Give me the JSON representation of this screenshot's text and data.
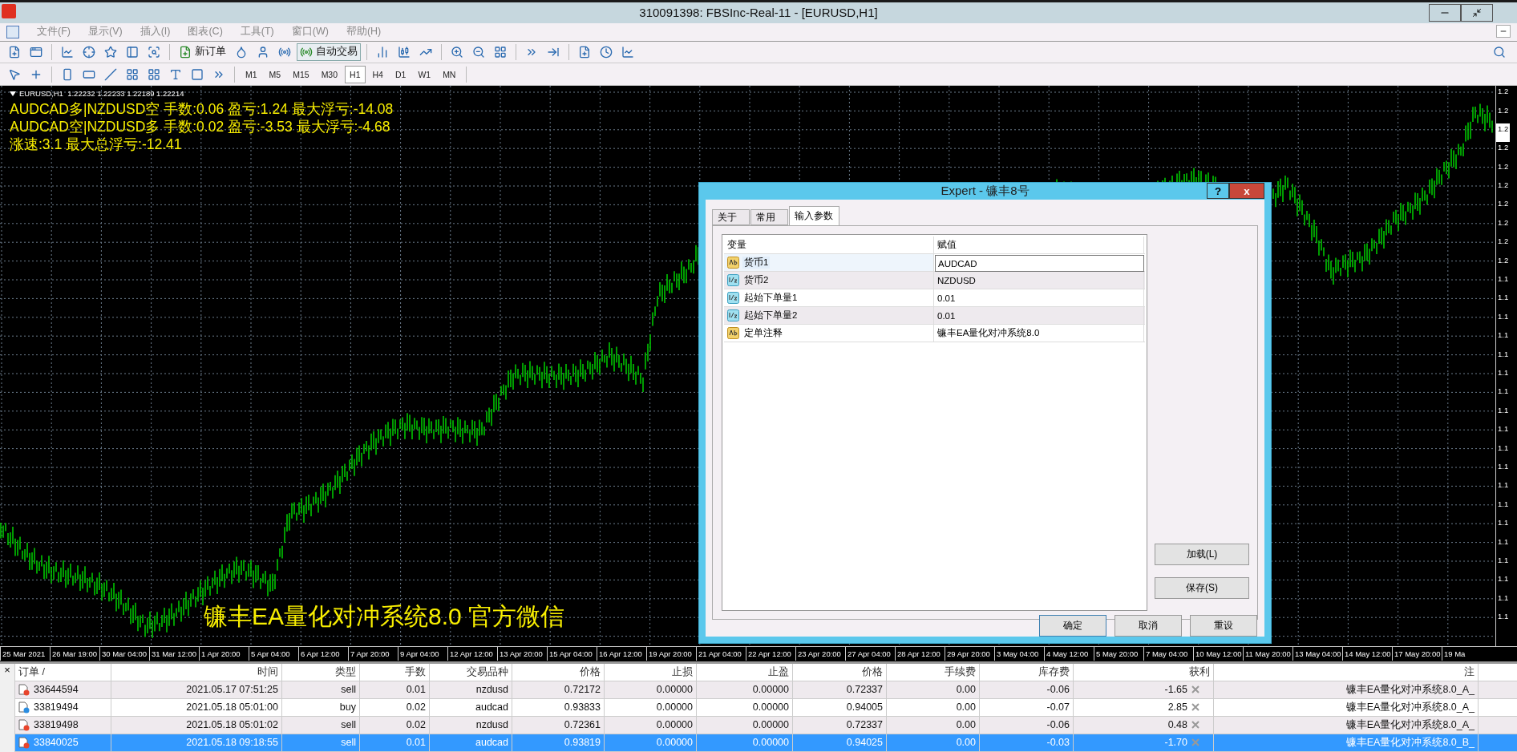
{
  "window": {
    "title": "310091398: FBSInc-Real-11 - [EURUSD,H1]"
  },
  "menu": [
    "文件(F)",
    "显示(V)",
    "插入(I)",
    "图表(C)",
    "工具(T)",
    "窗口(W)",
    "帮助(H)"
  ],
  "toolbar": {
    "buttons": [
      "新订单",
      "自动交易"
    ]
  },
  "timeframes": [
    {
      "label": "M1",
      "selected": false
    },
    {
      "label": "M5",
      "selected": false
    },
    {
      "label": "M15",
      "selected": false
    },
    {
      "label": "M30",
      "selected": false
    },
    {
      "label": "H1",
      "selected": true
    },
    {
      "label": "H4",
      "selected": false
    },
    {
      "label": "D1",
      "selected": false
    },
    {
      "label": "W1",
      "selected": false
    },
    {
      "label": "MN",
      "selected": false
    }
  ],
  "chart": {
    "header": "EURUSD,H1  1.22232 1.22233 1.22189 1.22214",
    "overlay_lines": [
      "AUDCAD多|NZDUSD空  手数:0.06  盈亏:1.24  最大浮亏:-14.08",
      "AUDCAD空|NZDUSD多  手数:0.02  盈亏:-3.53  最大浮亏:-4.68",
      "涨速:3.1  最大总浮亏:-12.41"
    ],
    "banner": "镰丰EA量化对冲系统8.0  官方微信",
    "price_labels": [
      {
        "text": "1.2",
        "current": false
      },
      {
        "text": "1.2",
        "current": false
      },
      {
        "text": "1.2",
        "current": true
      },
      {
        "text": "1.2",
        "current": false
      },
      {
        "text": "1.2",
        "current": false
      },
      {
        "text": "1.2",
        "current": false
      },
      {
        "text": "1.2",
        "current": false
      },
      {
        "text": "1.2",
        "current": false
      },
      {
        "text": "1.2",
        "current": false
      },
      {
        "text": "1.2",
        "current": false
      },
      {
        "text": "1.1",
        "current": false
      },
      {
        "text": "1.1",
        "current": false
      },
      {
        "text": "1.1",
        "current": false
      },
      {
        "text": "1.1",
        "current": false
      },
      {
        "text": "1.1",
        "current": false
      },
      {
        "text": "1.1",
        "current": false
      },
      {
        "text": "1.1",
        "current": false
      },
      {
        "text": "1.1",
        "current": false
      },
      {
        "text": "1.1",
        "current": false
      },
      {
        "text": "1.1",
        "current": false
      },
      {
        "text": "1.1",
        "current": false
      },
      {
        "text": "1.1",
        "current": false
      },
      {
        "text": "1.1",
        "current": false
      },
      {
        "text": "1.1",
        "current": false
      },
      {
        "text": "1.1",
        "current": false
      },
      {
        "text": "1.1",
        "current": false
      },
      {
        "text": "1.1",
        "current": false
      },
      {
        "text": "1.1",
        "current": false
      },
      {
        "text": "1.1",
        "current": false
      }
    ],
    "time_labels": [
      "25 Mar 2021",
      "26 Mar 19:00",
      "30 Mar 04:00",
      "31 Mar 12:00",
      "1 Apr 20:00",
      "5 Apr 04:00",
      "6 Apr 12:00",
      "7 Apr 20:00",
      "9 Apr 04:00",
      "12 Apr 12:00",
      "13 Apr 20:00",
      "15 Apr 04:00",
      "16 Apr 12:00",
      "19 Apr 20:00",
      "21 Apr 04:00",
      "22 Apr 12:00",
      "23 Apr 20:00",
      "27 Apr 04:00",
      "28 Apr 12:00",
      "29 Apr 20:00",
      "3 May 04:00",
      "4 May 12:00",
      "5 May 20:00",
      "7 May 04:00",
      "10 May 12:00",
      "11 May 20:00",
      "13 May 04:00",
      "14 May 12:00",
      "17 May 20:00",
      "19 Ma"
    ]
  },
  "dialog": {
    "title": "Expert - 镰丰8号",
    "help": "?",
    "close": "x",
    "tabs": [
      {
        "label": "关于",
        "selected": false
      },
      {
        "label": "常用",
        "selected": false
      },
      {
        "label": "输入参数",
        "selected": true
      }
    ],
    "columns": [
      "变量",
      "赋值"
    ],
    "params": [
      {
        "kind": "string",
        "name": "货币1",
        "value": "AUDCAD",
        "selected": true
      },
      {
        "kind": "double",
        "name": "货币2",
        "value": "NZDUSD",
        "selected": false
      },
      {
        "kind": "double",
        "name": "起始下单量1",
        "value": "0.01",
        "selected": false
      },
      {
        "kind": "double",
        "name": "起始下单量2",
        "value": "0.01",
        "selected": false
      },
      {
        "kind": "string",
        "name": "定单注释",
        "value": "镰丰EA量化对冲系统8.0",
        "selected": false
      }
    ],
    "side_buttons": [
      "加载(L)",
      "保存(S)"
    ],
    "bottom_buttons": [
      "确定",
      "取消",
      "重设"
    ]
  },
  "terminal": {
    "close": "×",
    "columns": [
      "订单  /",
      "时间",
      "类型",
      "手数",
      "交易品种",
      "价格",
      "止损",
      "止盈",
      "价格",
      "手续费",
      "库存费",
      "获利",
      "注"
    ],
    "rows": [
      {
        "color": "#e8452c",
        "selected": false,
        "cells": [
          "33644594",
          "2021.05.17 07:51:25",
          "sell",
          "0.01",
          "nzdusd",
          "0.72172",
          "0.00000",
          "0.00000",
          "0.72337",
          "0.00",
          "-0.06",
          "-1.65",
          "镰丰EA量化对冲系统8.0_A_"
        ]
      },
      {
        "color": "#2b8de0",
        "selected": false,
        "cells": [
          "33819494",
          "2021.05.18 05:01:00",
          "buy",
          "0.02",
          "audcad",
          "0.93833",
          "0.00000",
          "0.00000",
          "0.94005",
          "0.00",
          "-0.07",
          "2.85",
          "镰丰EA量化对冲系统8.0_A_"
        ]
      },
      {
        "color": "#e8452c",
        "selected": false,
        "cells": [
          "33819498",
          "2021.05.18 05:01:02",
          "sell",
          "0.02",
          "nzdusd",
          "0.72361",
          "0.00000",
          "0.00000",
          "0.72337",
          "0.00",
          "-0.06",
          "0.48",
          "镰丰EA量化对冲系统8.0_A_"
        ]
      },
      {
        "color": "#e8452c",
        "selected": true,
        "cells": [
          "33840025",
          "2021.05.18 09:18:55",
          "sell",
          "0.01",
          "audcad",
          "0.93819",
          "0.00000",
          "0.00000",
          "0.94025",
          "0.00",
          "-0.03",
          "-1.70",
          "镰丰EA量化对冲系统8.0_B_"
        ]
      }
    ]
  }
}
